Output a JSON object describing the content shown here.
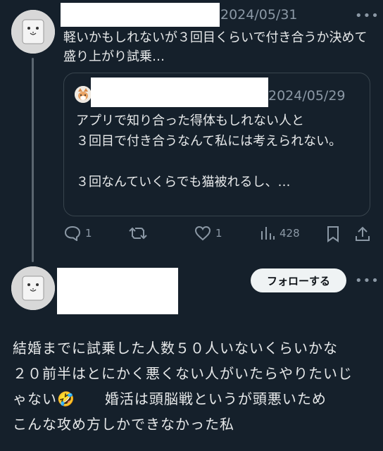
{
  "post1": {
    "date": "2024/05/31",
    "more_label": "•••",
    "text": "軽いかもしれないが３回目くらいで付き合うか決めて盛り上がり試乗…",
    "quote": {
      "date": "2024/05/29",
      "text": "アプリで知り合った得体もしれない人と\n３回目で付き合うなんて私には考えられない。\n\n３回なんていくらでも猫被れるし、…"
    },
    "actions": {
      "reply_count": "1",
      "retweet_count": "",
      "like_count": "1",
      "views_count": "428"
    }
  },
  "post2": {
    "follow_label": "フォローする",
    "more_label": "•••",
    "text_lines": [
      "結婚までに試乗した人数５０人いないくらいかな",
      "２０前半はとにかく悪くない人がいたらやりたいじ",
      "ゃない🤣　　婚活は頭脳戦というが頭悪いため",
      "こんな攻め方しかできなかった私"
    ]
  }
}
